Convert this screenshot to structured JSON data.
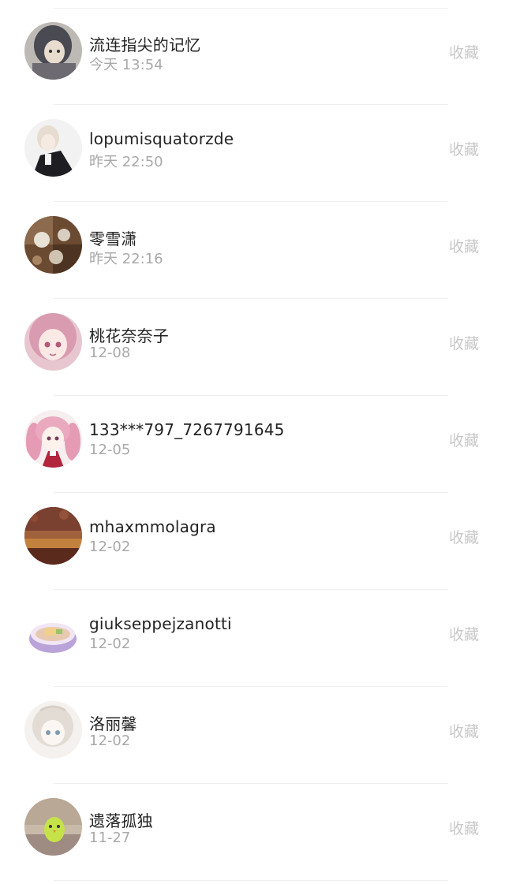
{
  "items": [
    {
      "name": "流连指尖的记忆",
      "time": "今天 13:54",
      "action": "收藏",
      "avatar": "avatar-anime-girl-grey"
    },
    {
      "name": "lopumisquatorzde",
      "time": "昨天 22:50",
      "action": "收藏",
      "avatar": "avatar-anime-boy-black-suit"
    },
    {
      "name": "零雪潇",
      "time": "昨天 22:16",
      "action": "收藏",
      "avatar": "avatar-collage-brown"
    },
    {
      "name": "桃花奈奈子",
      "time": "12-08",
      "action": "收藏",
      "avatar": "avatar-anime-girl-pink"
    },
    {
      "name": "133***797_7267791645",
      "time": "12-05",
      "action": "收藏",
      "avatar": "avatar-anime-girl-pink-twintails"
    },
    {
      "name": "mhaxmmolagra",
      "time": "12-02",
      "action": "收藏",
      "avatar": "avatar-landscape-autumn"
    },
    {
      "name": "giukseppejzanotti",
      "time": "12-02",
      "action": "收藏",
      "avatar": "avatar-noodle-bowl"
    },
    {
      "name": "洛丽馨",
      "time": "12-02",
      "action": "收藏",
      "avatar": "avatar-anime-girl-white"
    },
    {
      "name": "遗落孤独",
      "time": "11-27",
      "action": "收藏",
      "avatar": "avatar-green-chick"
    }
  ]
}
